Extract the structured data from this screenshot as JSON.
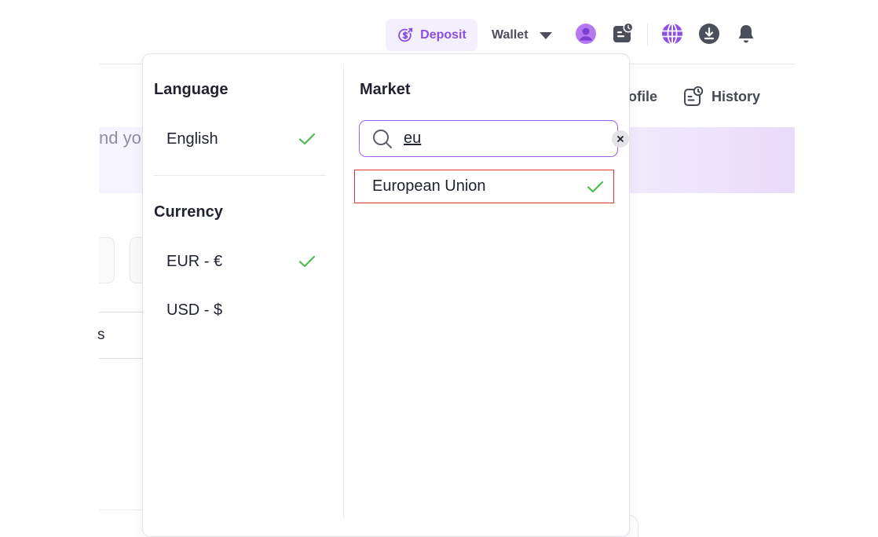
{
  "header": {
    "deposit_label": "Deposit",
    "wallet_label": "Wallet",
    "icons": [
      "deposit-icon",
      "caret-down-icon",
      "user-avatar-icon",
      "rewards-icon",
      "globe-icon",
      "download-icon",
      "bell-icon"
    ]
  },
  "background": {
    "profile_link_label": "ofile",
    "history_link_label": "History",
    "banner_text": "nd yo",
    "tab_fragment": "s"
  },
  "dropdown": {
    "language": {
      "title": "Language",
      "options": [
        {
          "label": "English",
          "selected": true
        }
      ]
    },
    "currency": {
      "title": "Currency",
      "options": [
        {
          "label": "EUR - €",
          "selected": true
        },
        {
          "label": "USD - $",
          "selected": false
        }
      ]
    },
    "market": {
      "title": "Market",
      "search": {
        "value": "eu"
      },
      "results": [
        {
          "label": "European Union",
          "selected": true
        }
      ]
    }
  },
  "colors": {
    "accent": "#8c4fe3",
    "check": "#4cba4c",
    "highlight_border": "#e0372f"
  }
}
